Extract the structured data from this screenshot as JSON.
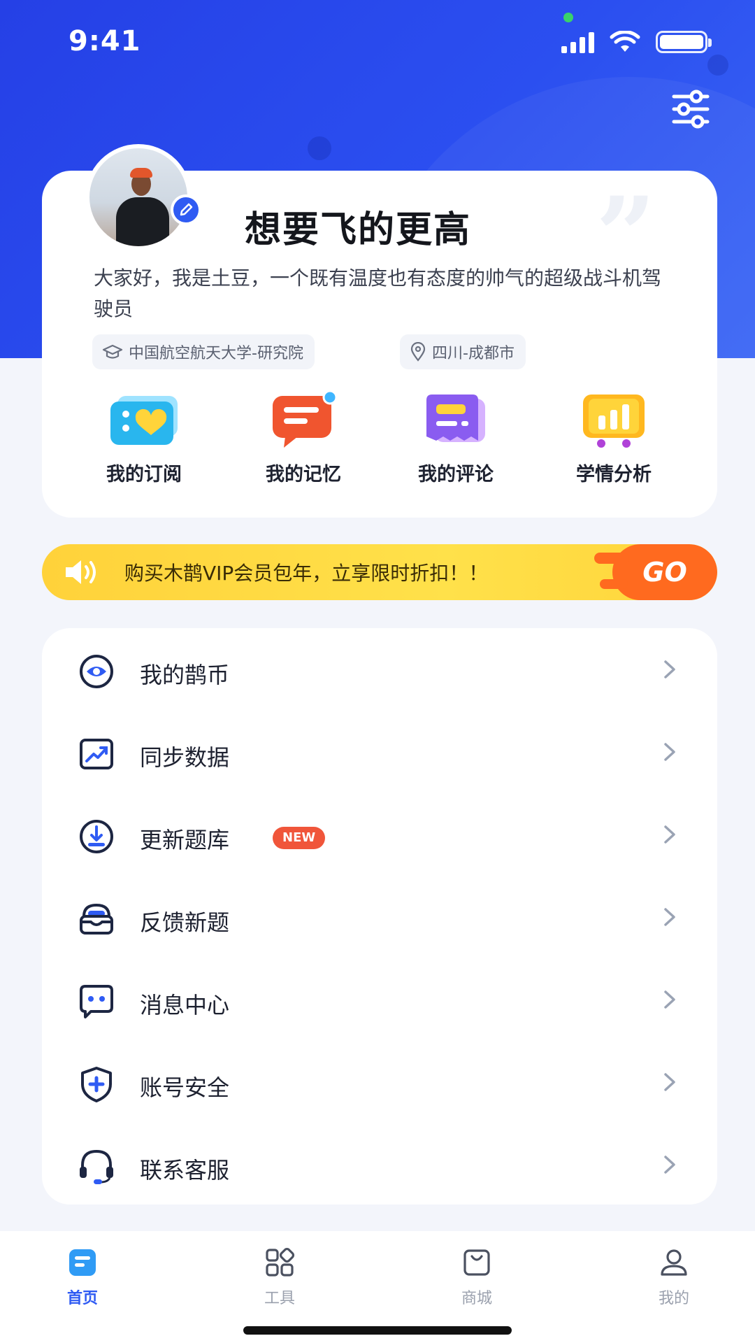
{
  "status_bar": {
    "time": "9:41"
  },
  "profile": {
    "name": "想要飞的更高",
    "bio": "大家好，我是土豆，一个既有温度也有态度的帅气的超级战斗机驾驶员",
    "school": "中国航空航天大学-研究院",
    "location": "四川-成都市"
  },
  "quick_actions": [
    {
      "label": "我的订阅",
      "icon": "ticket-heart-icon"
    },
    {
      "label": "我的记忆",
      "icon": "chat-bubble-icon"
    },
    {
      "label": "我的评论",
      "icon": "comment-card-icon"
    },
    {
      "label": "学情分析",
      "icon": "bar-chart-icon"
    }
  ],
  "vip_banner": {
    "text": "购买木鹊VIP会员包年，立享限时折扣！！",
    "go_label": "GO"
  },
  "menu": [
    {
      "label": "我的鹊币",
      "icon": "coin-eye-icon"
    },
    {
      "label": "同步数据",
      "icon": "chart-trend-icon"
    },
    {
      "label": "更新题库",
      "icon": "download-circle-icon",
      "badge": "NEW"
    },
    {
      "label": "反馈新题",
      "icon": "inbox-icon"
    },
    {
      "label": "消息中心",
      "icon": "message-icon"
    },
    {
      "label": "账号安全",
      "icon": "shield-plus-icon"
    },
    {
      "label": "联系客服",
      "icon": "headset-icon"
    }
  ],
  "tabs": [
    {
      "label": "首页",
      "icon": "home-icon",
      "active": true
    },
    {
      "label": "工具",
      "icon": "grid-icon",
      "active": false
    },
    {
      "label": "商城",
      "icon": "bag-icon",
      "active": false
    },
    {
      "label": "我的",
      "icon": "user-icon",
      "active": false
    }
  ],
  "colors": {
    "primary": "#2f5bf3",
    "header_gradient_start": "#2540e6",
    "vip_yellow": "#ffd23a",
    "go_orange": "#ff6a1f",
    "badge_red": "#f0553a"
  }
}
